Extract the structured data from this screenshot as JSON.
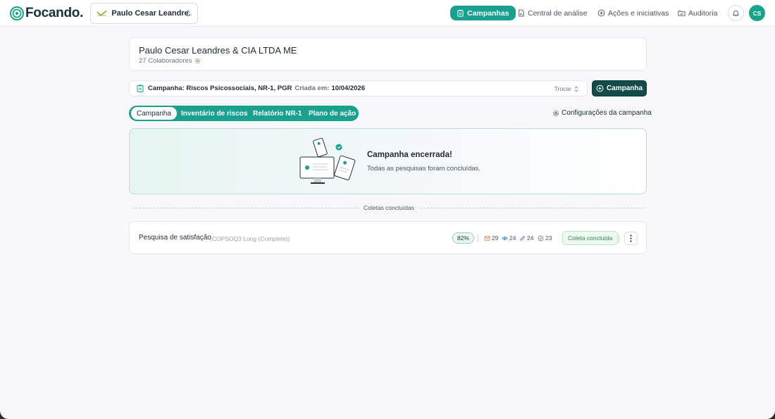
{
  "brand": {
    "name": "Focando.",
    "accent": "#1aa08f",
    "dark_button": "#134a48"
  },
  "org_selector": {
    "name": "Paulo Cesar Leandre..."
  },
  "nav": [
    {
      "label": "Campanhas",
      "icon": "clipboard-icon",
      "active": true
    },
    {
      "label": "Central de análise",
      "icon": "document-chart-icon",
      "active": false
    },
    {
      "label": "Ações e iniciativas",
      "icon": "plus-circle-icon",
      "active": false
    },
    {
      "label": "Auditoria",
      "icon": "folder-check-icon",
      "active": false
    }
  ],
  "user": {
    "initials": "CS"
  },
  "company": {
    "name": "Paulo Cesar Leandres & CIA LTDA ME",
    "collaborators": "27 Colaboradores"
  },
  "campaign": {
    "label": "Campanha: Riscos Psicossociais, NR-1, PGR",
    "created_prefix": "Criada em:",
    "created_date": "10/04/2026",
    "switch_label": "Trocar",
    "new_button": "Campanha"
  },
  "tabs": [
    {
      "label": "Campanha",
      "active": true
    },
    {
      "label": "Inventário de riscos",
      "active": false
    },
    {
      "label": "Relatório NR-1",
      "active": false
    },
    {
      "label": "Plano de ação",
      "active": false
    }
  ],
  "config_link": "Configurações da campanha",
  "banner": {
    "title": "Campanha encerrada!",
    "subtitle": "Todas as pesquisas foram concluídas."
  },
  "section_label": "Coletas concluídas",
  "survey": {
    "title": "Pesquisa de satisfação",
    "tag": "(COPSOQ3 Long (Complete))",
    "percent": "82%",
    "sent": "29",
    "viewed": "24",
    "answered": "24",
    "completed": "23",
    "status": "Coleta concluída"
  }
}
